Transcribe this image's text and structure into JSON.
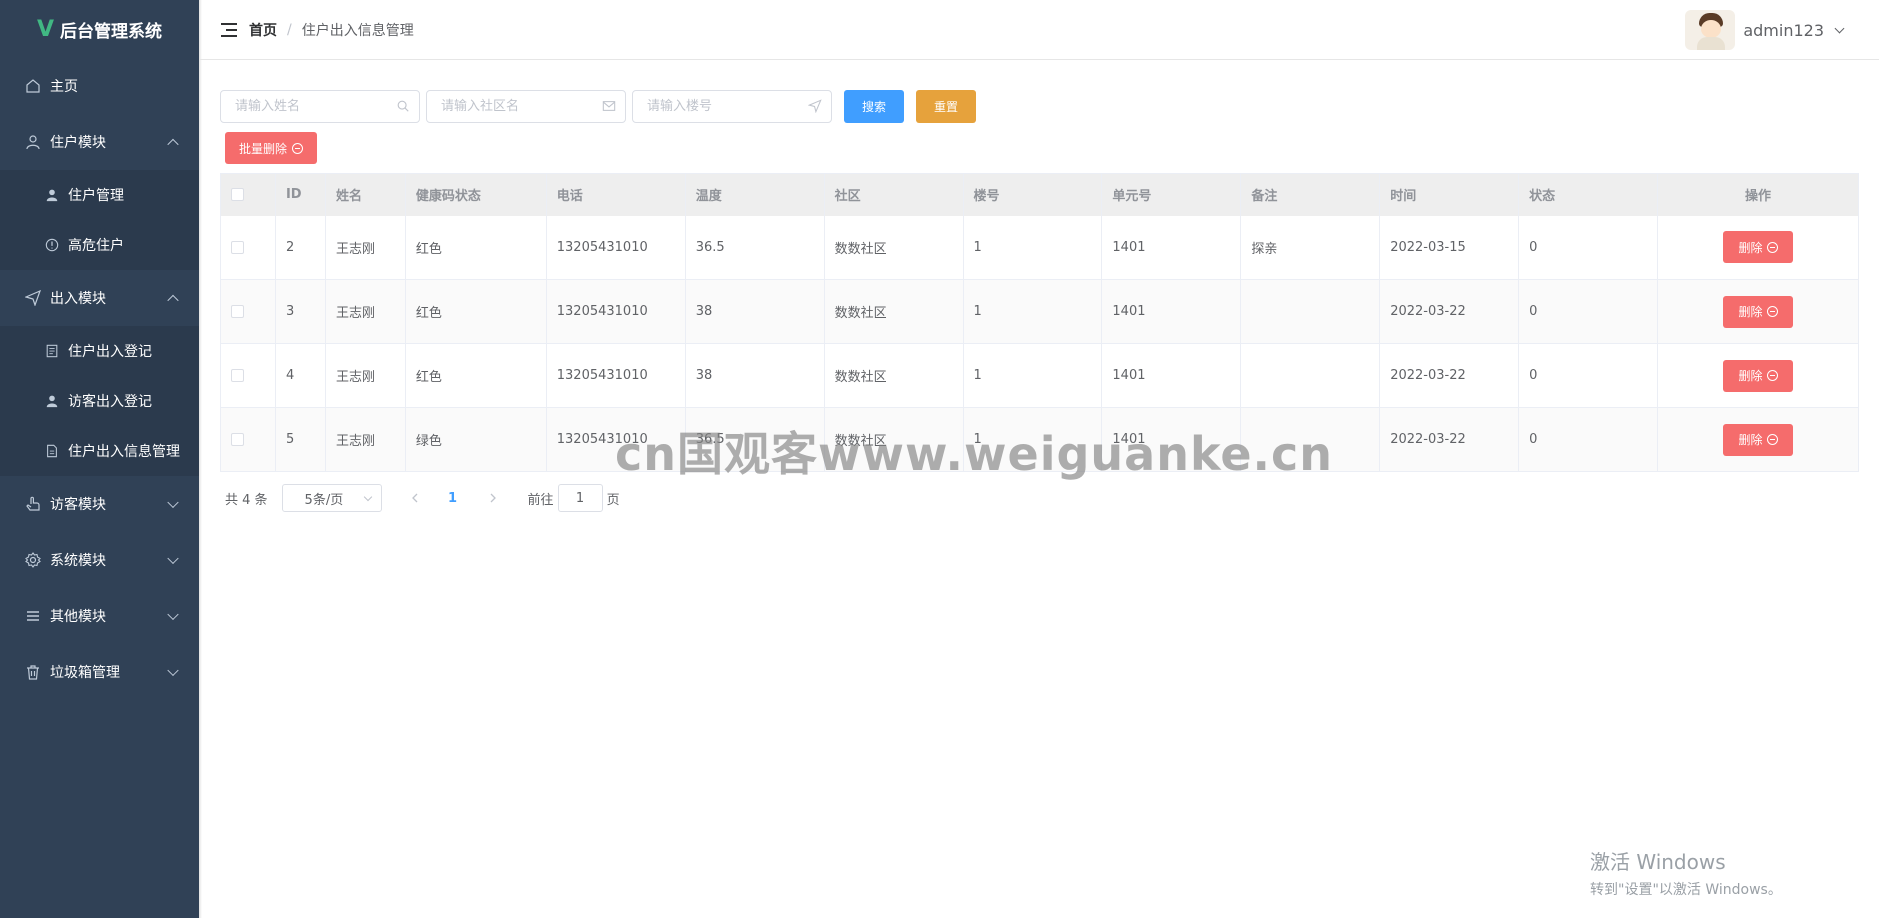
{
  "sidebar": {
    "logo_letter": "V",
    "logo_text": "后台管理系统",
    "menu": {
      "home": "主页",
      "resident_module": "住户模块",
      "resident_manage": "住户管理",
      "high_risk": "高危住户",
      "access_module": "出入模块",
      "resident_access_register": "住户出入登记",
      "visitor_access_register": "访客出入登记",
      "resident_access_info": "住户出入信息管理",
      "visitor_module": "访客模块",
      "system_module": "系统模块",
      "other_module": "其他模块",
      "trash_manage": "垃圾箱管理"
    }
  },
  "header": {
    "breadcrumb_home": "首页",
    "breadcrumb_sep": "/",
    "breadcrumb_current": "住户出入信息管理",
    "username": "admin123"
  },
  "filters": {
    "name_placeholder": "请输入姓名",
    "community_placeholder": "请输入社区名",
    "building_placeholder": "请输入楼号",
    "search_label": "搜索",
    "reset_label": "重置",
    "batch_delete_label": "批量删除"
  },
  "table": {
    "headers": [
      "ID",
      "姓名",
      "健康码状态",
      "电话",
      "温度",
      "社区",
      "楼号",
      "单元号",
      "备注",
      "时间",
      "状态",
      "操作"
    ],
    "rows": [
      {
        "id": "2",
        "name": "王志刚",
        "health": "红色",
        "phone": "13205431010",
        "temp": "36.5",
        "community": "数数社区",
        "building": "1",
        "unit": "1401",
        "note": "探亲",
        "time": "2022-03-15",
        "status": "0",
        "action": "删除"
      },
      {
        "id": "3",
        "name": "王志刚",
        "health": "红色",
        "phone": "13205431010",
        "temp": "38",
        "community": "数数社区",
        "building": "1",
        "unit": "1401",
        "note": "",
        "time": "2022-03-22",
        "status": "0",
        "action": "删除"
      },
      {
        "id": "4",
        "name": "王志刚",
        "health": "红色",
        "phone": "13205431010",
        "temp": "38",
        "community": "数数社区",
        "building": "1",
        "unit": "1401",
        "note": "",
        "time": "2022-03-22",
        "status": "0",
        "action": "删除"
      },
      {
        "id": "5",
        "name": "王志刚",
        "health": "绿色",
        "phone": "13205431010",
        "temp": "36.5",
        "community": "数数社区",
        "building": "1",
        "unit": "1401",
        "note": "",
        "time": "2022-03-22",
        "status": "0",
        "action": "删除"
      }
    ]
  },
  "pagination": {
    "total": "共 4 条",
    "page_size": "5条/页",
    "current_page": "1",
    "goto_label": "前往",
    "goto_value": "1",
    "page_unit": "页"
  },
  "watermark": {
    "text": "cn国观客www.weiguanke.cn",
    "activate_title": "激活 Windows",
    "activate_sub": "转到\"设置\"以激活 Windows。"
  },
  "colors": {
    "sidebar_bg": "#304156",
    "primary": "#409eff",
    "warning": "#e6a23c",
    "danger": "#f56c6c"
  }
}
